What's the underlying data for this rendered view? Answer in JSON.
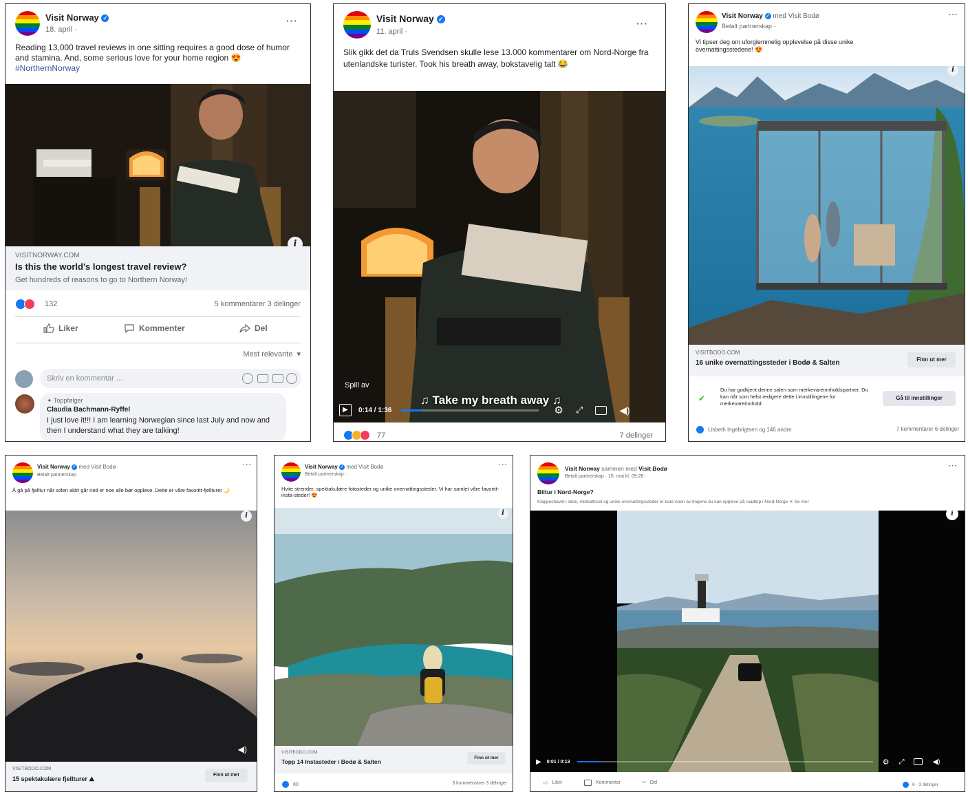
{
  "posts": {
    "p1": {
      "page": "Visit Norway",
      "time": "18. april ·",
      "text": "Reading 13,000 travel reviews in one sitting requires a good dose of humor and stamina. And, some serious love for your home region 😍",
      "hashtag": "#NorthernNorway",
      "domain": "VISITNORWAY.COM",
      "title": "Is this the world's longest travel review?",
      "desc": "Get hundreds of reasons to go to Northern Norway!",
      "reactions": "132",
      "stats": "5 kommentarer  3 delinger",
      "like": "Liker",
      "comment": "Kommenter",
      "share": "Del",
      "sort": "Mest relevante",
      "comment_placeholder": "Skriv en kommentar ...",
      "top_fan": "Toppfølger",
      "commenter": "Claudia Bachmann-Ryffel",
      "comment_text": "I just love it!!! I am learning Norwegian since last July and now and then I understand what they are talking!"
    },
    "p2": {
      "page": "Visit Norway",
      "time": "11. april ·",
      "text": "Slik gikk det da Truls Svendsen skulle lese 13.000 kommentarer om Nord-Norge fra utenlandske turister. Took his breath away, bokstavelig talt 😂",
      "replay": "Spill av",
      "time_code": "0:14 / 1:36",
      "subtitle": "♫ Take my breath away ♫",
      "reactions": "77",
      "stats": "7 delinger",
      "progress": 0.15
    },
    "p3": {
      "page": "Visit Norway",
      "with": "med Visit Bodø",
      "time": "Betalt partnerskap ·",
      "text": "Vi tipser deg om uforglemmelig opplevelse på disse unike overnattingsstedene! 😍",
      "domain": "VISITBODO.COM",
      "title": "16 unike overnattingssteder i Bodø & Salten",
      "cta": "Finn ut mer",
      "notice": "Du har godkjent denne siden som merkevareinnholdspartner. Du kan når som helst redigere dette i innstillingene for merkevareinnhold.",
      "notice_cta": "Gå til innstillinger",
      "reactions": "Lisbeth Ingebrigtsen og 146 andre",
      "stats": "7 kommentarer  6 delinger"
    },
    "p4": {
      "page": "Visit Norway",
      "with": "med Visit Bodø",
      "time": "Betalt partnerskap ·",
      "text": "Å gå på fjelltur når solen aldri går ned er noe alle bør oppleve. Dette er våre favoritt-fjellturer 🌙",
      "domain": "VISITBODO.COM",
      "title": "15 spektakulære fjellturer ⛰",
      "cta": "Finn ut mer"
    },
    "p5": {
      "page": "Visit Norway",
      "with": "med Visit Bodø",
      "time": "Betalt partnerskap ·",
      "text": "Hvite strender, spektakulære fotosteder og unike overnattingssteder. Vi har samlet våre favoritt-insta-steder! 😍",
      "domain": "VISITBODO.COM",
      "title": "Topp 14 Instasteder i Bodø & Salten",
      "cta": "Finn ut mer",
      "reactions": "80",
      "stats": "3 kommentarer  3 delinger"
    },
    "p6": {
      "page": "Visit Norway",
      "with": "sammen med",
      "partner": "Visit Bodø",
      "time": "Betalt partnerskap · 15. mai kl. 09:28 ·",
      "headline": "Biltur i Nord-Norge?",
      "text": "Klappeshavet i sikte, midnattssol og unike overnattingssteder er bare noen av tingene du kan oppleve på roadtrip i Nord-Norge ☀ Se mer",
      "time_code": "0:01 / 0:13",
      "like": "Liker",
      "comment": "Kommenter",
      "share": "Del",
      "stats": "6 · 3 delinger",
      "progress": 0.08
    }
  },
  "colors": {
    "accent": "#1877f2",
    "love": "#f33e58",
    "haha": "#f7b125",
    "border": "#2b2b2b",
    "muted": "#65676b",
    "link_bg": "#f0f2f5"
  },
  "icons": {
    "like": "thumbs-up-icon",
    "comment": "speech-bubble-icon",
    "share": "share-arrow-icon",
    "more": "ellipsis-icon",
    "info": "info-icon",
    "play": "play-icon",
    "settings": "gear-icon",
    "fullscreen": "expand-icon",
    "pip": "picture-in-picture-icon",
    "volume": "speaker-icon",
    "verified": "verified-badge-icon"
  }
}
